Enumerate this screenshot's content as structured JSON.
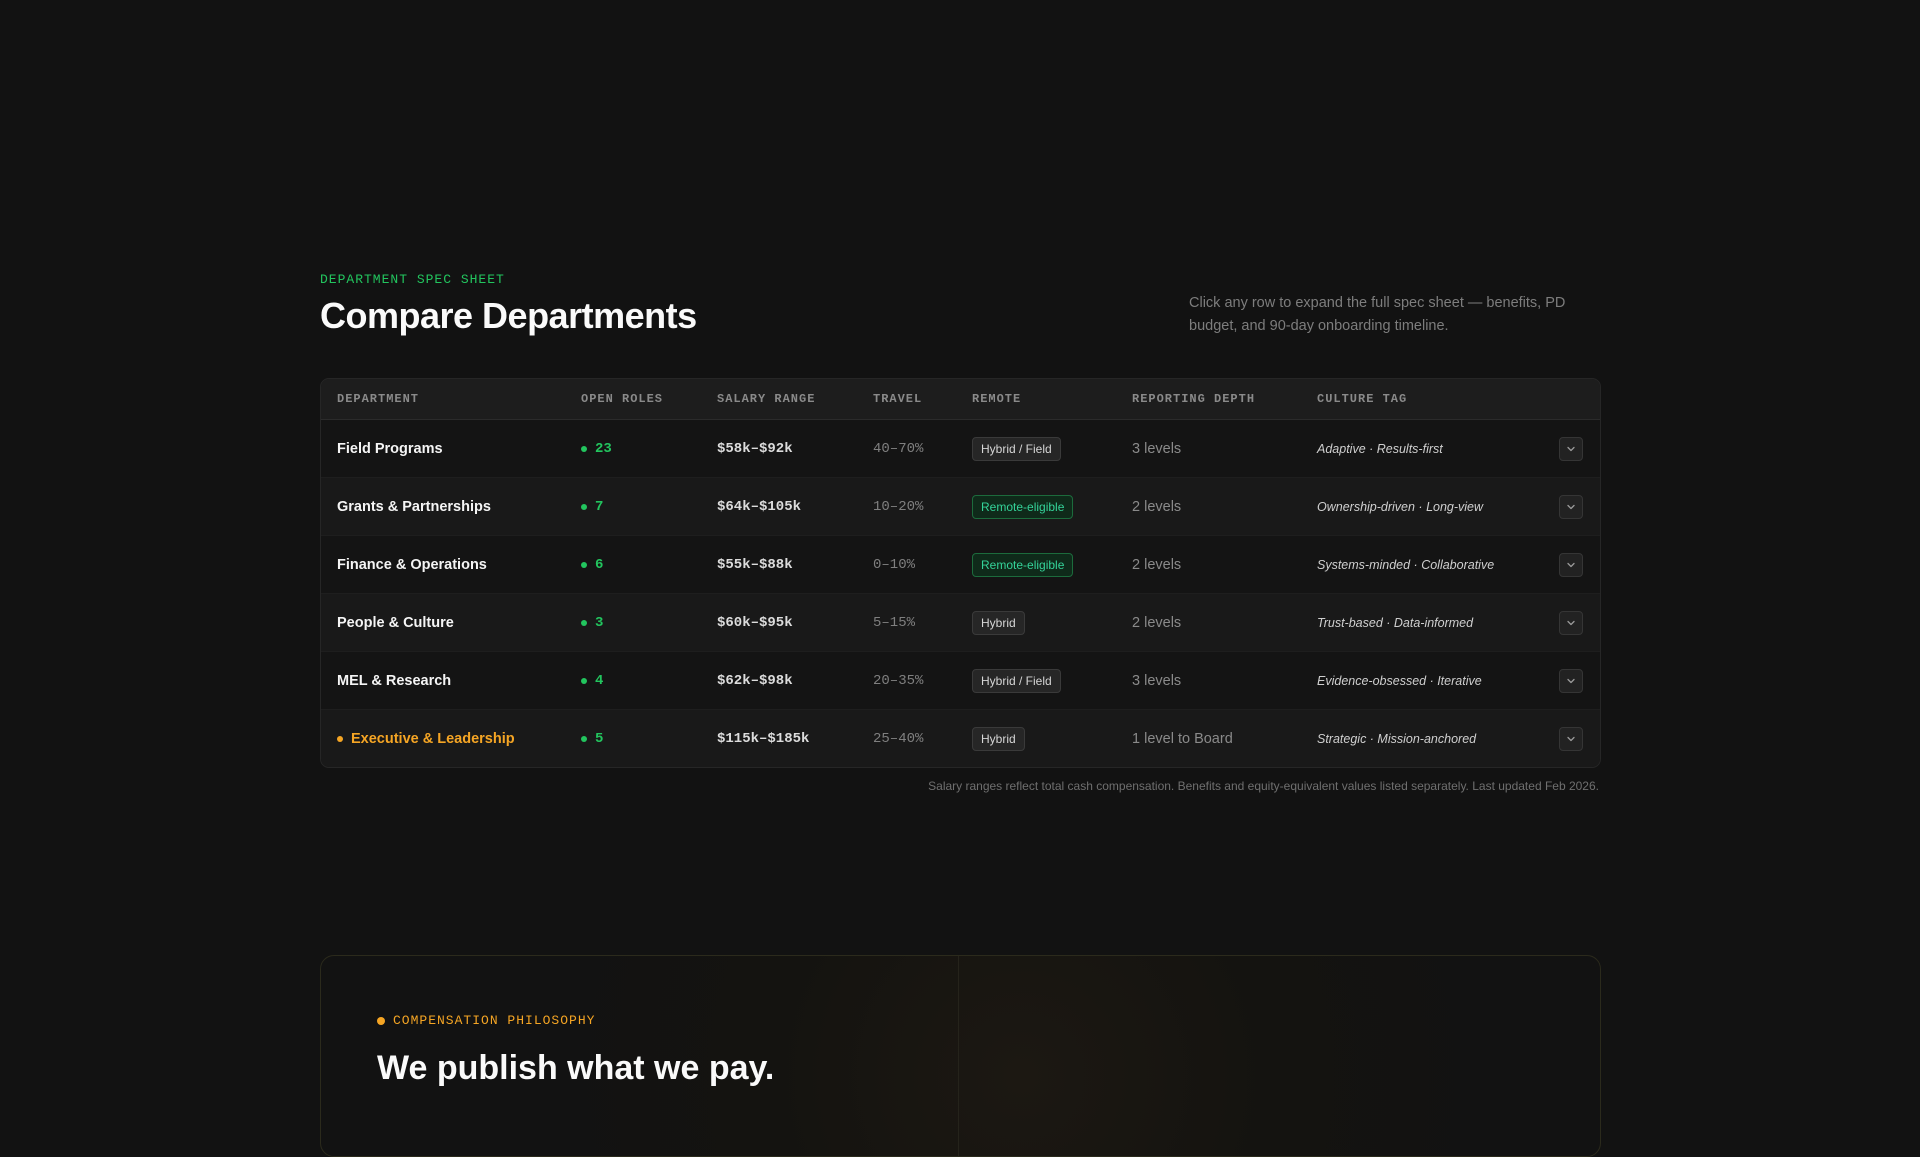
{
  "header": {
    "eyebrow": "DEPARTMENT SPEC SHEET",
    "title": "Compare Departments",
    "intro": "Click any row to expand the full spec sheet — benefits, PD budget, and 90-day onboarding timeline."
  },
  "table": {
    "columns": [
      "DEPARTMENT",
      "OPEN ROLES",
      "SALARY RANGE",
      "TRAVEL",
      "REMOTE",
      "REPORTING DEPTH",
      "CULTURE TAG"
    ],
    "rows": [
      {
        "department": "Field Programs",
        "open_roles": "23",
        "salary": "$58k–$92k",
        "travel": "40–70%",
        "remote": "Hybrid / Field",
        "remote_style": "neutral",
        "depth": "3 levels",
        "culture": "Adaptive · Results-first"
      },
      {
        "department": "Grants & Partnerships",
        "open_roles": "7",
        "salary": "$64k–$105k",
        "travel": "10–20%",
        "remote": "Remote-eligible",
        "remote_style": "green",
        "depth": "2 levels",
        "culture": "Ownership-driven · Long-view"
      },
      {
        "department": "Finance & Operations",
        "open_roles": "6",
        "salary": "$55k–$88k",
        "travel": "0–10%",
        "remote": "Remote-eligible",
        "remote_style": "green",
        "depth": "2 levels",
        "culture": "Systems-minded · Collaborative"
      },
      {
        "department": "People & Culture",
        "open_roles": "3",
        "salary": "$60k–$95k",
        "travel": "5–15%",
        "remote": "Hybrid",
        "remote_style": "neutral",
        "depth": "2 levels",
        "culture": "Trust-based · Data-informed"
      },
      {
        "department": "MEL & Research",
        "open_roles": "4",
        "salary": "$62k–$98k",
        "travel": "20–35%",
        "remote": "Hybrid / Field",
        "remote_style": "neutral",
        "depth": "3 levels",
        "culture": "Evidence-obsessed · Iterative"
      },
      {
        "department": "Executive & Leadership",
        "open_roles": "5",
        "salary": "$115k–$185k",
        "travel": "25–40%",
        "remote": "Hybrid",
        "remote_style": "neutral",
        "depth": "1 level to Board",
        "culture": "Strategic · Mission-anchored"
      }
    ],
    "footnote": "Salary ranges reflect total cash compensation. Benefits and equity-equivalent values listed separately. Last updated Feb 2026."
  },
  "philosophy": {
    "eyebrow": "COMPENSATION PHILOSOPHY",
    "title": "We publish what we pay."
  },
  "colors": {
    "accent_green": "#22c55e",
    "accent_amber": "#f5a524",
    "background": "#121212"
  },
  "icons": {
    "expand": "chevron-down-icon"
  }
}
